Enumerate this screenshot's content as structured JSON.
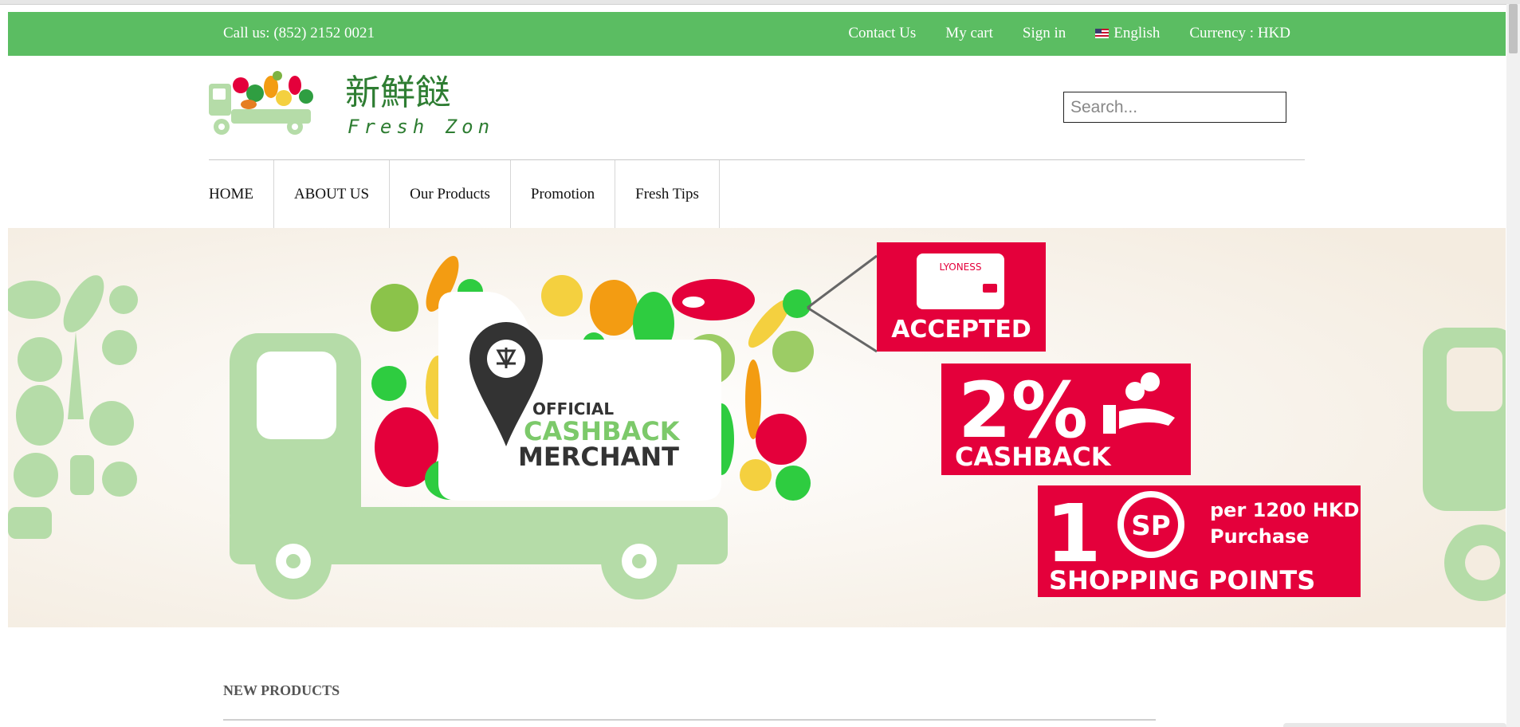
{
  "topbar": {
    "phone": "Call us: (852) 2152 0021",
    "contact": "Contact Us",
    "cart": "My cart",
    "signin": "Sign in",
    "language": "English",
    "currency": "Currency : HKD",
    "bg_color": "#5bbd62"
  },
  "logo": {
    "chinese": "新鮮餸",
    "english": "Fresh Zone"
  },
  "search": {
    "placeholder": "Search..."
  },
  "nav": {
    "items": [
      "HOME",
      "ABOUT US",
      "Our Products",
      "Promotion",
      "Fresh Tips"
    ]
  },
  "banner": {
    "badge_official": "OFFICIAL",
    "badge_cashback": "CASHBACK",
    "badge_merchant": "MERCHANT",
    "brand": "LYONESS",
    "accepted": "ACCEPTED",
    "cashback_pct": "2%",
    "cashback_label": "CASHBACK",
    "points_num": "1",
    "sp": "SP",
    "per_purchase_1": "per 1200 HKD",
    "per_purchase_2": "Purchase",
    "shopping_points": "SHOPPING POINTS",
    "accent_red": "#e4003b",
    "truck_green": "#b5dca8"
  },
  "main": {
    "section_title": "NEW PRODUCTS"
  }
}
